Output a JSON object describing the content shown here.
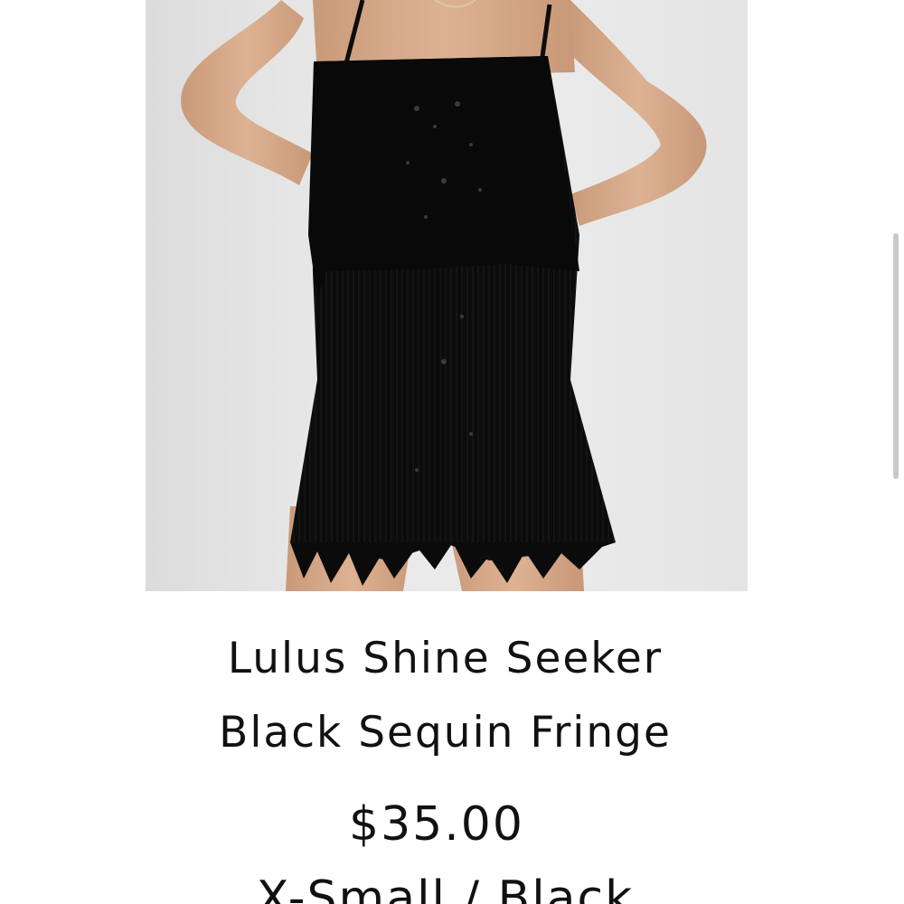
{
  "product": {
    "title_line1": "Lulus Shine Seeker",
    "title_line2": "Black Sequin Fringe",
    "price": "$35.00",
    "variant": "X-Small / Black"
  },
  "colors": {
    "background": "#ffffff",
    "text": "#111111",
    "garment": "#0c0c0c"
  }
}
